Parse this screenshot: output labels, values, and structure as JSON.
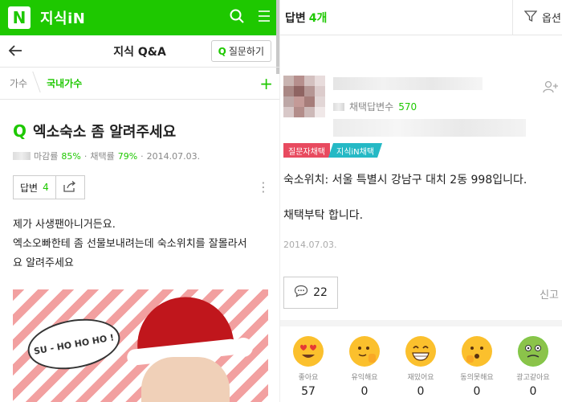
{
  "left": {
    "app_logo": "N",
    "app_title": "지식iN",
    "nav_title": "지식 Q&A",
    "ask_button": "질문하기",
    "ask_icon": "Q",
    "breadcrumb": [
      "가수",
      "국내가수"
    ],
    "question": {
      "icon": "Q",
      "title": "엑소숙소 좀 알려주세요",
      "close_label": "마감률",
      "close_rate": "85%",
      "adopt_label": "채택률",
      "adopt_rate": "79%",
      "date": "2014.07.03.",
      "answer_label": "답변",
      "answer_count": "4",
      "body_line1": "제가 사생팬아니거든요.",
      "body_line2": "엑소오빠한테 좀 선물보내려는데 숙소위치를 잘몰라서",
      "body_line3": "요 알려주세요"
    },
    "photo_bubble_text": "SU - HO HO HO !"
  },
  "right": {
    "header_label": "답변",
    "header_count": "4개",
    "sort_label": "옵션",
    "chosen_label": "채택답변수",
    "chosen_count": "570",
    "badge_asker": "질문자채택",
    "badge_kin": "지식iN채택",
    "answer_line1": "숙소위치: 서울 특별시 강남구 대치 2동 998입니다.",
    "answer_line2": "채택부탁 합니다.",
    "answer_date": "2014.07.03.",
    "comment_count": "22",
    "report_label": "신고",
    "reactions": [
      {
        "label": "좋아요",
        "count": "57",
        "icon": "heart-eyes-icon"
      },
      {
        "label": "유익해요",
        "count": "0",
        "icon": "thumbs-up-icon"
      },
      {
        "label": "재밌어요",
        "count": "0",
        "icon": "grin-icon"
      },
      {
        "label": "동의못해요",
        "count": "0",
        "icon": "confused-icon"
      },
      {
        "label": "광고같아요",
        "count": "0",
        "icon": "sick-icon"
      }
    ]
  },
  "colors": {
    "brand_green": "#1ec800",
    "badge_red": "#e84a5f",
    "badge_teal": "#25b9c5"
  }
}
